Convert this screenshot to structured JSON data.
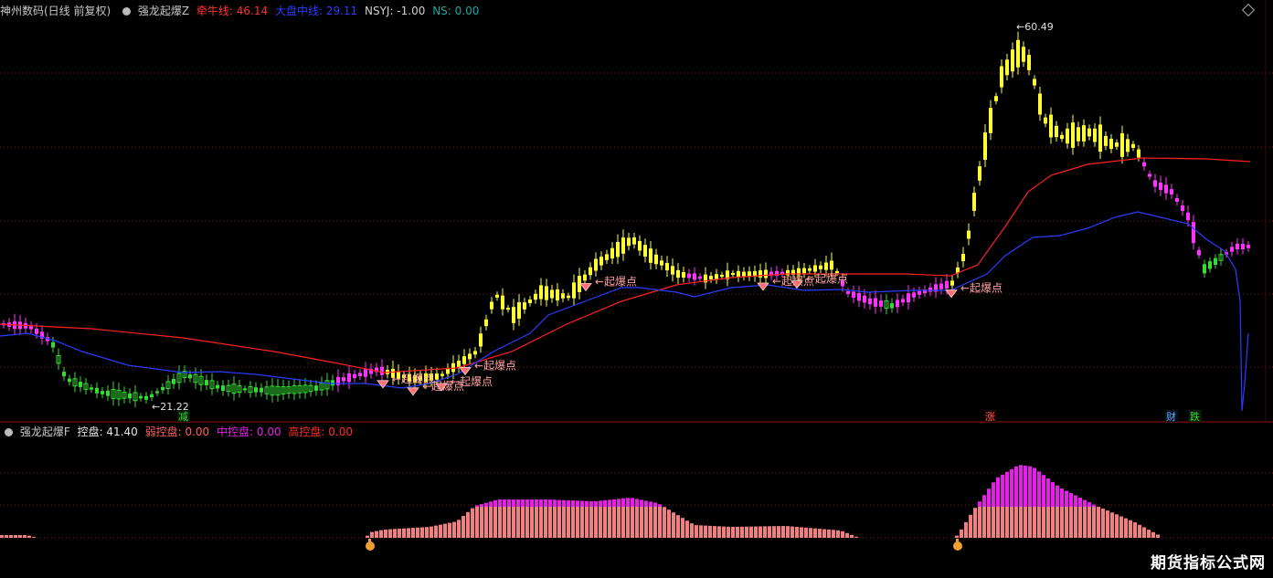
{
  "header": {
    "title": "神州数码(日线 前复权)",
    "indicator_name": "强龙起爆Z",
    "bull_label": "牵牛线: 46.14",
    "market_label": "大盘中线: 29.11",
    "nsyj_label": "NSYJ: -1.00",
    "ns_label": "NS: 0.00"
  },
  "subpanel": {
    "name": "强龙起爆F",
    "control_label": "控盘: 41.40",
    "weak_label": "弱控盘: 0.00",
    "mid_label": "中控盘: 0.00",
    "high_label": "高控盘: 0.00"
  },
  "annotations": {
    "high_price": "60.49",
    "low_price": "21.22",
    "burst_label": "起爆点",
    "marker_reduce": "减",
    "marker_rise": "涨",
    "marker_finance": "财",
    "marker_fall": "跌"
  },
  "watermark": "期货指标公式网",
  "colors": {
    "background": "#000000",
    "bull_line": "#ff2020",
    "market_line": "#2a3cff",
    "up_candle": "#ffff33",
    "down_candle": "#ff33ff",
    "weak_candle": "#33dd33",
    "volume_base": "#f08080",
    "volume_top": "#e620e6"
  }
}
